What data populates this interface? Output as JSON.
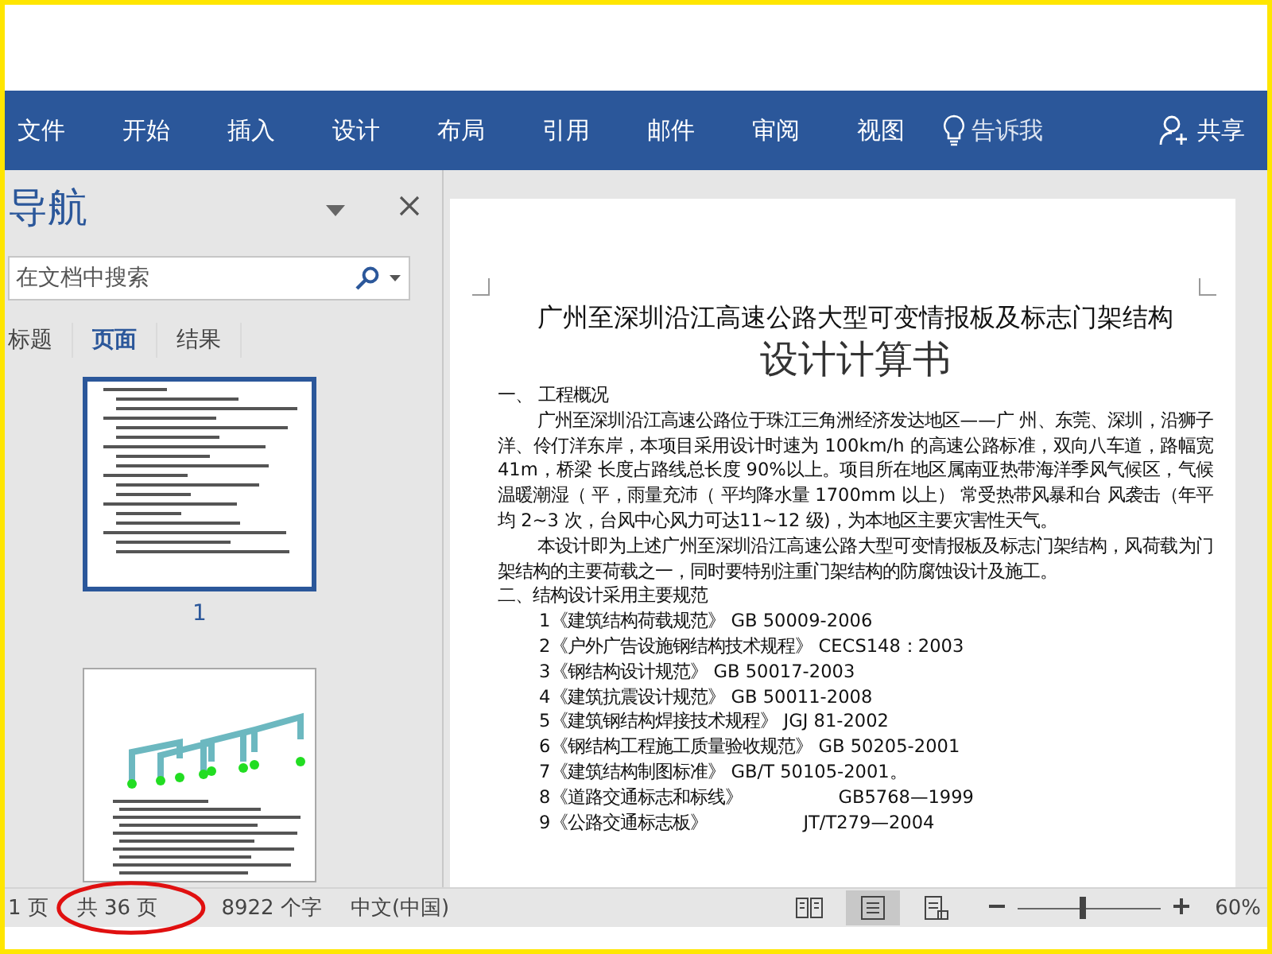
{
  "ribbon": {
    "tabs": [
      "文件",
      "开始",
      "插入",
      "设计",
      "布局",
      "引用",
      "邮件",
      "审阅",
      "视图"
    ],
    "tell_me": "告诉我",
    "share": "共享"
  },
  "navigation": {
    "title": "导航",
    "search": {
      "placeholder": "在文档中搜索"
    },
    "tabs": [
      {
        "label": "标题",
        "selected": false
      },
      {
        "label": "页面",
        "selected": true
      },
      {
        "label": "结果",
        "selected": false
      }
    ],
    "pages": [
      {
        "number": "1",
        "selected": true,
        "kind": "text"
      },
      {
        "kind": "frame",
        "selected": false
      }
    ]
  },
  "document": {
    "title": "广州至深圳沿江高速公路大型可变情报板及标志门架结构",
    "subtitle": "设计计算书",
    "blocks": [
      {
        "kind": "heading",
        "text": "一、 工程概况"
      },
      {
        "kind": "para",
        "text": "广州至深圳沿江高速公路位于珠江三角洲经济发达地区——广 州、东莞、深圳，沿狮子洋、伶仃洋东岸，本项目采用设计时速为 100km/h 的高速公路标准，双向八车道，路幅宽 41m，桥梁 长度占路线总长度 90%以上。项目所在地区属南亚热带海洋季风气候区，气候温暖潮湿（ 平，雨量充沛（ 平均降水量 1700mm 以上） 常受热带风暴和台 风袭击（年平均 2~3 次，台风中心风力可达11~12 级)，为本地区主要灾害性天气。"
      },
      {
        "kind": "para",
        "text": "本设计即为上述广州至深圳沿江高速公路大型可变情报板及标志门架结构，风荷载为门架结构的主要荷载之一，同时要特别注重门架结构的防腐蚀设计及施工。"
      },
      {
        "kind": "heading",
        "text": "二、结构设计采用主要规范"
      },
      {
        "kind": "ref",
        "text": "1《建筑结构荷载规范》 GB 50009-2006"
      },
      {
        "kind": "ref",
        "text": "2《户外广告设施钢结构技术规程》 CECS148：2003"
      },
      {
        "kind": "ref",
        "text": "3《钢结构设计规范》 GB 50017-2003"
      },
      {
        "kind": "ref",
        "text": "4《建筑抗震设计规范》 GB 50011-2008"
      },
      {
        "kind": "ref",
        "text": "5《建筑钢结构焊接技术规程》 JGJ 81-2002"
      },
      {
        "kind": "ref",
        "text": "6《钢结构工程施工质量验收规范》 GB 50205-2001"
      },
      {
        "kind": "ref",
        "text": "7《建筑结构制图标准》 GB/T 50105-2001。"
      },
      {
        "kind": "ref_tab",
        "text": "8《道路交通标志和标线》",
        "code": "GB5768—1999"
      },
      {
        "kind": "ref_tab",
        "text": "9《公路交通标志板》",
        "code": "JT/T279—2004"
      }
    ]
  },
  "status_bar": {
    "page": "1 页",
    "total": "共 36 页",
    "words": "8922 个字",
    "language": "中文(中国)",
    "views": [
      {
        "kind": "read",
        "selected": false
      },
      {
        "kind": "print",
        "selected": true
      },
      {
        "kind": "web",
        "selected": false
      }
    ],
    "zoom": {
      "level": 0.45,
      "reading": "60%"
    }
  },
  "annotation": {
    "kind": "ellipse"
  }
}
